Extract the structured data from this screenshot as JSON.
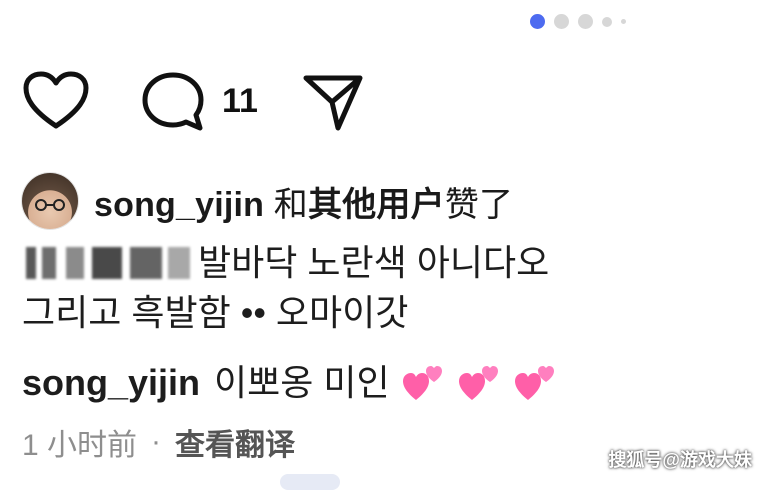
{
  "pager": {
    "count": 5,
    "active_index": 0
  },
  "actions": {
    "like_icon": "heart-outline-icon",
    "comment_icon": "comment-bubble-icon",
    "comment_count": "11",
    "share_icon": "paper-plane-icon"
  },
  "likes": {
    "avatar_icon": "user-avatar",
    "username": "song_yijin",
    "and_text": "和",
    "others_text": "其他用户",
    "liked_text": "赞了"
  },
  "comments": [
    {
      "username": "",
      "text_line1": "발바닥 노란색 아니다오",
      "text_line2": "그리고 흑발함 •• 오마이갓"
    },
    {
      "username": "song_yijin",
      "text": "이뽀옹 미인",
      "emoji": [
        "two-hearts-icon",
        "two-hearts-icon",
        "two-hearts-icon"
      ]
    }
  ],
  "meta": {
    "time": "1 小时前",
    "separator": "·",
    "translate": "查看翻译"
  },
  "watermark": "搜狐号@游戏大妹",
  "colors": {
    "accent": "#4d6bf0",
    "text": "#1a1a1a",
    "muted": "#8e8e8e",
    "heart": "#ff5fa8"
  }
}
